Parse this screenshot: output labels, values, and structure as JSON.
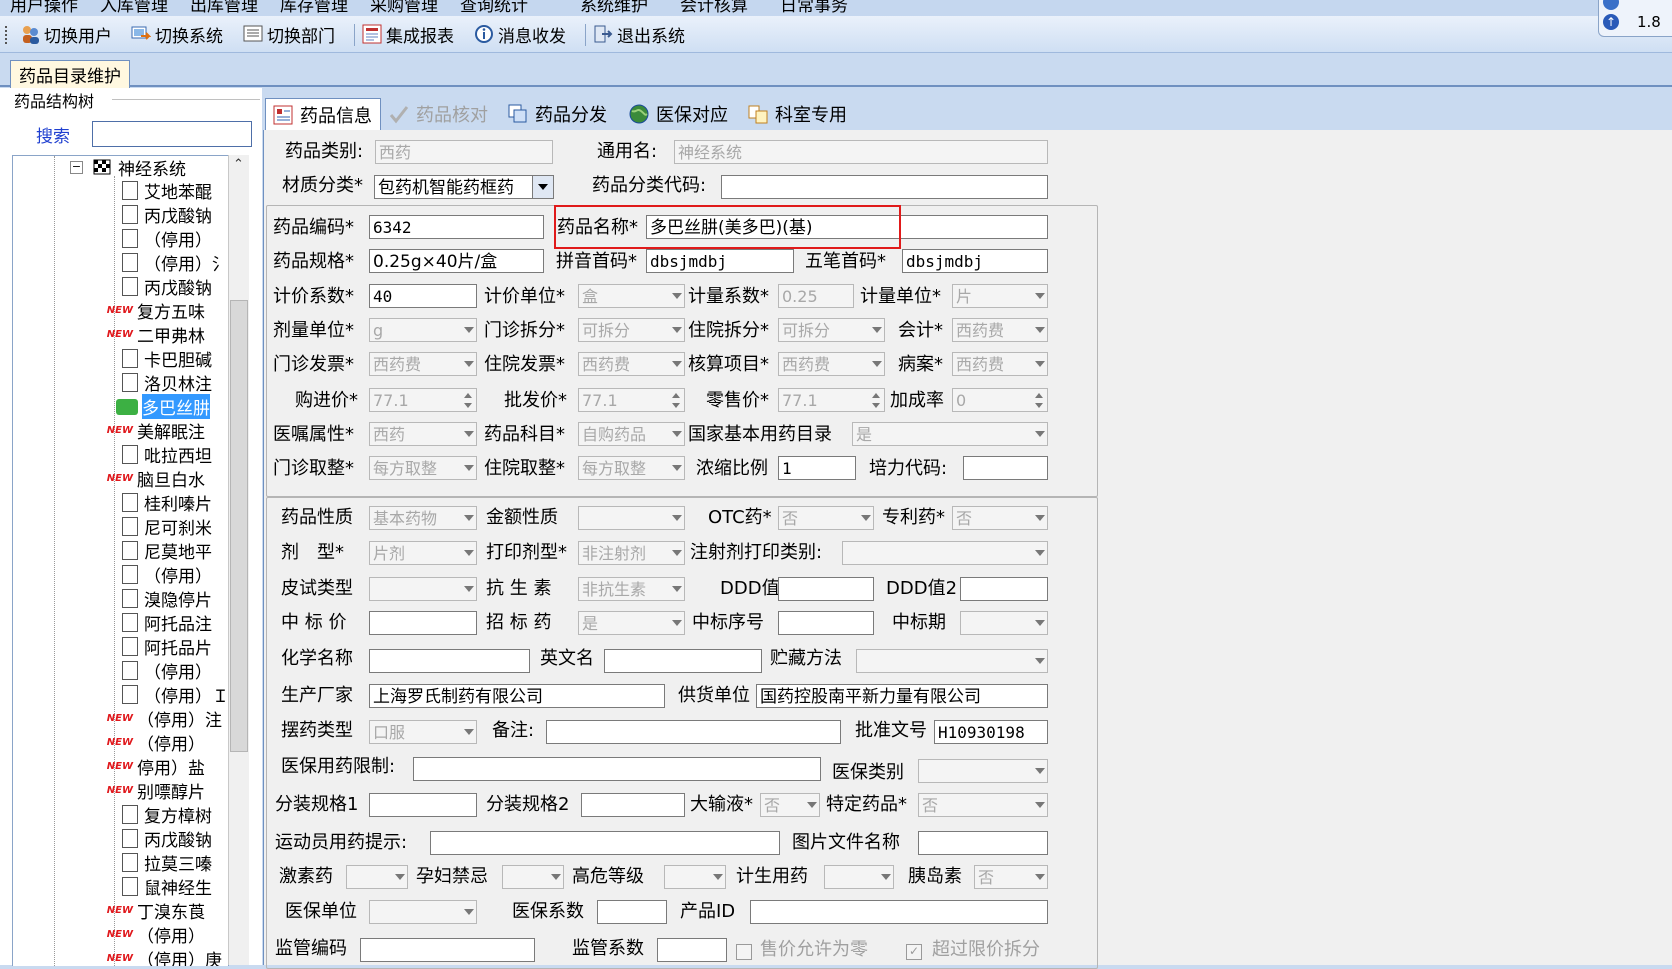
{
  "menu": [
    "用户操作",
    "入库管理",
    "出库管理",
    "库存管理",
    "采购管理",
    "查询统计",
    "系统维护",
    "会计核算",
    "日常事务"
  ],
  "toolbar": {
    "switch_user": "切换用户",
    "switch_system": "切换系统",
    "switch_dept": "切换部门",
    "reports": "集成报表",
    "messages": "消息收发",
    "exit": "退出系统"
  },
  "version": {
    "line1": "1.8"
  },
  "main_tab": "药品目录维护",
  "tree": {
    "title": "药品结构树",
    "search_label": "搜索",
    "root": "神经系统",
    "items": [
      {
        "label": "艾地苯醌",
        "new": false
      },
      {
        "label": "丙戊酸钠",
        "new": false
      },
      {
        "label": "（停用）",
        "new": false
      },
      {
        "label": "（停用）氵",
        "new": false
      },
      {
        "label": "丙戊酸钠",
        "new": false
      },
      {
        "label": "复方五味",
        "new": true
      },
      {
        "label": "二甲弗林",
        "new": true
      },
      {
        "label": "卡巴胆碱",
        "new": false
      },
      {
        "label": "洛贝林注",
        "new": false
      },
      {
        "label": "多巴丝肼",
        "new": false,
        "selected": true
      },
      {
        "label": "美解眠注",
        "new": true
      },
      {
        "label": "吡拉西坦",
        "new": false
      },
      {
        "label": "脑旦白水",
        "new": true
      },
      {
        "label": "桂利嗪片",
        "new": false
      },
      {
        "label": "尼可刹米",
        "new": false
      },
      {
        "label": "尼莫地平",
        "new": false
      },
      {
        "label": "（停用）",
        "new": false
      },
      {
        "label": "溴隐停片",
        "new": false
      },
      {
        "label": "阿托品注",
        "new": false
      },
      {
        "label": "阿托品片",
        "new": false
      },
      {
        "label": "（停用）",
        "new": false
      },
      {
        "label": "（停用）Ｉ",
        "new": false
      },
      {
        "label": "（停用）注",
        "new": true
      },
      {
        "label": "（停用）",
        "new": true
      },
      {
        "label": "停用）盐",
        "new": true
      },
      {
        "label": "别嘌醇片",
        "new": true
      },
      {
        "label": "复方樟树",
        "new": false
      },
      {
        "label": "丙戊酸钠",
        "new": false
      },
      {
        "label": "拉莫三嗪",
        "new": false
      },
      {
        "label": "鼠神经生",
        "new": false
      },
      {
        "label": "丁溴东莨",
        "new": true
      },
      {
        "label": "（停用）",
        "new": true
      },
      {
        "label": "（停用）庚",
        "new": true
      }
    ]
  },
  "tabs": [
    "药品信息",
    "药品核对",
    "药品分发",
    "医保对应",
    "科室专用"
  ],
  "form": {
    "category_label": "药品类别:",
    "category": "西药",
    "generic_label": "通用名:",
    "generic": "神经系统",
    "material_label": "材质分类*",
    "material": "包药机智能药框药",
    "classcode_label": "药品分类代码:",
    "code_label": "药品编码*",
    "code": "6342",
    "name_label": "药品名称*",
    "name": "多巴丝肼(美多巴)(基)",
    "spec_label": "药品规格*",
    "spec": "0.25g×40片/盒",
    "pinyin_label": "拼音首码*",
    "pinyin": "dbsjmdbj",
    "wubi_label": "五笔首码*",
    "wubi": "dbsjmdbj",
    "pricecoef_label": "计价系数*",
    "pricecoef": "40",
    "priceunit_label": "计价单位*",
    "priceunit": "盒",
    "measurecoef_label": "计量系数*",
    "measurecoef": "0.25",
    "measureunit_label": "计量单位*",
    "measureunit": "片",
    "doseunit_label": "剂量单位*",
    "doseunit": "g",
    "opsplit_label": "门诊拆分*",
    "opsplit": "可拆分",
    "ipsplit_label": "住院拆分*",
    "ipsplit": "可拆分",
    "account_label": "会计*",
    "account": "西药费",
    "opinvoice_label": "门诊发票*",
    "opinvoice": "西药费",
    "ipinvoice_label": "住院发票*",
    "ipinvoice": "西药费",
    "acctitem_label": "核算项目*",
    "acctitem": "西药费",
    "casebook_label": "病案*",
    "casebook": "西药费",
    "purchase_label": "购进价*",
    "purchase": "77.1",
    "wholesale_label": "批发价*",
    "wholesale": "77.1",
    "retail_label": "零售价*",
    "retail": "77.1",
    "markup_label": "加成率",
    "markup": "0",
    "orderattr_label": "医嘱属性*",
    "orderattr": "西药",
    "subject_label": "药品科目*",
    "subject": "自购药品",
    "essential_label": "国家基本用药目录",
    "essential": "是",
    "oprounding_label": "门诊取整*",
    "oprounding": "每方取整",
    "iprounding_label": "住院取整*",
    "iprounding": "每方取整",
    "concentration_label": "浓缩比例",
    "concentration": "1",
    "peili_label": "培力代码:",
    "nature_label": "药品性质",
    "nature": "基本药物",
    "amountnature_label": "金额性质",
    "otc_label": "OTC药*",
    "otc": "否",
    "patent_label": "专利药*",
    "patent": "否",
    "form_label": "剂　型*",
    "dosageform": "片剂",
    "printform_label": "打印剂型*",
    "printform": "非注射剂",
    "injprint_label": "注射剂打印类别:",
    "skintest_label": "皮试类型",
    "antibiotic_label": "抗 生 素",
    "antibiotic": "非抗生素",
    "ddd_label": "DDD值",
    "ddd2_label": "DDD值2",
    "bidprice_label": "中 标 价",
    "biddrug_label": "招 标 药",
    "biddrug": "是",
    "bidno_label": "中标序号",
    "bidperiod_label": "中标期",
    "chemname_label": "化学名称",
    "engname_label": "英文名",
    "storage_label": "贮藏方法",
    "maker_label": "生产厂家",
    "maker": "上海罗氏制药有限公司",
    "supplier_label": "供货单位",
    "supplier": "国药控股南平新力量有限公司",
    "placetype_label": "摆药类型",
    "placetype": "口服",
    "note_label": "备注:",
    "approval_label": "批准文号",
    "approval": "H10930198",
    "insrestrict_label": "医保用药限制:",
    "instype_label": "医保类别",
    "pack1_label": "分装规格1",
    "pack2_label": "分装规格2",
    "infusion_label": "大输液*",
    "infusion": "否",
    "special_label": "特定药品*",
    "special": "否",
    "athlete_label": "运动员用药提示:",
    "image_label": "图片文件名称",
    "hormone_label": "激素药",
    "pregnant_label": "孕妇禁忌",
    "risk_label": "高危等级",
    "family_label": "计生用药",
    "insulin_label": "胰岛素",
    "insulin": "否",
    "insunit_label": "医保单位",
    "inscoef_label": "医保系数",
    "productid_label": "产品ID",
    "supcode_label": "监管编码",
    "supcoef_label": "监管系数",
    "zeroprice_label": "售价允许为零",
    "oversplit_label": "超过限价拆分"
  }
}
